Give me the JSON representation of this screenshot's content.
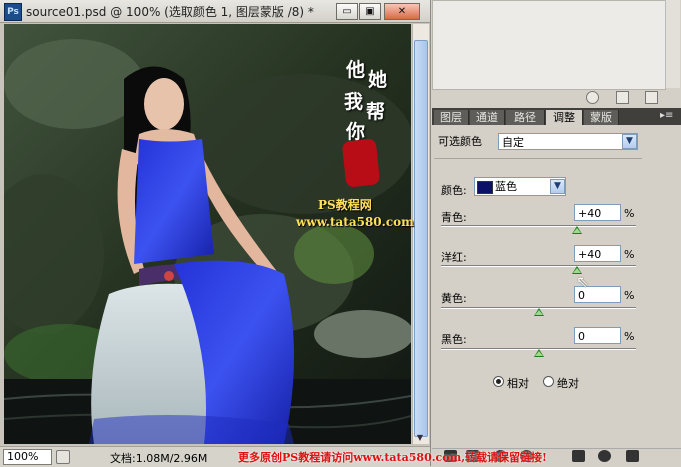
{
  "document": {
    "app_icon": "Ps",
    "title": "source01.psd @ 100% (选取颜色 1, 图层蒙版 /8) *",
    "controls": {
      "minimize": "▭",
      "restore": "▣",
      "close": "✕"
    },
    "zoom": "100%",
    "doc_info": "文档:1.08M/2.96M"
  },
  "watermark": {
    "chars": [
      "他",
      "她",
      "我",
      "帮",
      "你"
    ],
    "line1": "PS教程网",
    "line2": "www.tata580.com",
    "footer_text": "更多原创PS教程请访问www.tata580.com,转载请保留链接!"
  },
  "panel": {
    "tabs": [
      {
        "label": "图层",
        "active": false
      },
      {
        "label": "通道",
        "active": false
      },
      {
        "label": "路径",
        "active": false
      },
      {
        "label": "调整",
        "active": true
      },
      {
        "label": "蒙版",
        "active": false
      }
    ],
    "adjustment_name": "可选颜色",
    "preset": "自定",
    "color_label": "颜色:",
    "color_value": "蓝色",
    "color_swatch": "#0b1166",
    "sliders": [
      {
        "label": "青色:",
        "value": "+40",
        "unit": "%",
        "position": 0.7
      },
      {
        "label": "洋红:",
        "value": "+40",
        "unit": "%",
        "position": 0.7
      },
      {
        "label": "黄色:",
        "value": "0",
        "unit": "%",
        "position": 0.5
      },
      {
        "label": "黑色:",
        "value": "0",
        "unit": "%",
        "position": 0.5
      }
    ],
    "method": {
      "relative": "相对",
      "absolute": "绝对",
      "selected": "relative"
    }
  }
}
